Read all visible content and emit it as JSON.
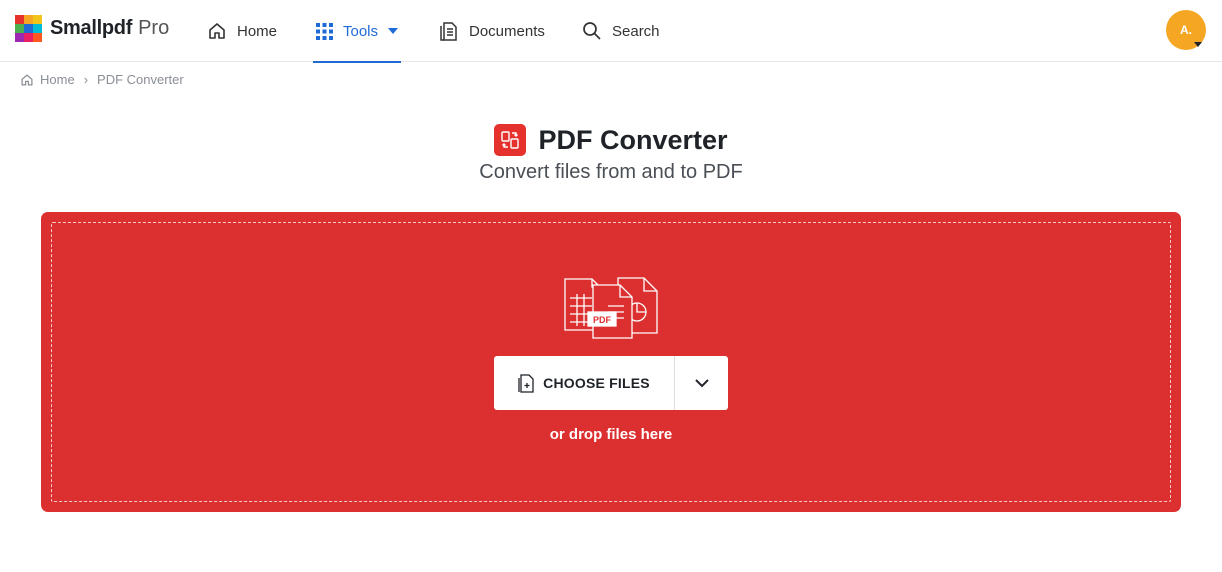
{
  "brand": {
    "name": "Smallpdf",
    "tier": "Pro",
    "logo_colors": [
      "#e5322d",
      "#f5a623",
      "#f0c419",
      "#4caf50",
      "#1f6bd6",
      "#9c27b0",
      "#00bcd4",
      "#ff5722",
      "#e91e63"
    ]
  },
  "nav": {
    "home": "Home",
    "tools": "Tools",
    "documents": "Documents",
    "search": "Search"
  },
  "user": {
    "initials": "A."
  },
  "breadcrumb": {
    "home": "Home",
    "current": "PDF Converter"
  },
  "page": {
    "title": "PDF Converter",
    "subtitle": "Convert files from and to PDF"
  },
  "dropzone": {
    "choose_label": "CHOOSE FILES",
    "hint": "or drop files here",
    "badge": "PDF"
  },
  "colors": {
    "accent": "#1f6bd6",
    "dropzone": "#dc2f2f",
    "tool_icon": "#e5322d",
    "avatar": "#f5a623"
  },
  "icons": {
    "home": "home-icon",
    "tools": "grid-icon",
    "documents": "documents-icon",
    "search": "search-icon",
    "convert": "convert-icon",
    "file_add": "file-add-icon",
    "chevron": "chevron-down-icon"
  }
}
